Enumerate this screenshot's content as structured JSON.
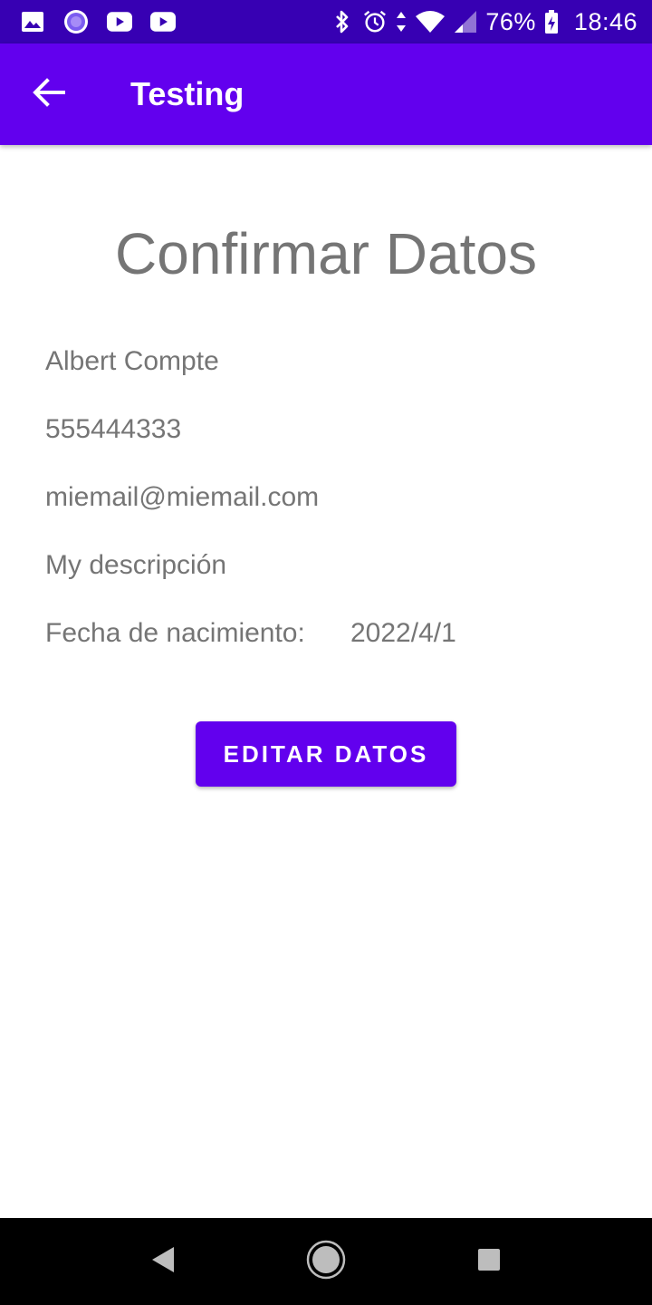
{
  "status_bar": {
    "notification_icons": [
      "image-icon",
      "loading-icon",
      "youtube-icon",
      "youtube-icon"
    ],
    "system_icons": [
      "bluetooth-icon",
      "alarm-icon",
      "data-arrows-icon",
      "wifi-icon",
      "signal-icon"
    ],
    "battery": "76%",
    "battery_icon": "battery-charging-icon",
    "time": "18:46"
  },
  "app_bar": {
    "back_icon": "arrow-back-icon",
    "title": "Testing",
    "color": "#6200ee",
    "status_color": "#3700b3"
  },
  "content": {
    "heading": "Confirmar Datos",
    "name": "Albert Compte",
    "phone": "555444333",
    "email": "miemail@miemail.com",
    "description": "My descripción",
    "birth_label": "Fecha de nacimiento:",
    "birth_value": "2022/4/1",
    "text_color": "#757575"
  },
  "actions": {
    "edit_label": "EDITAR DATOS"
  },
  "nav_bar": {
    "icons": [
      "nav-back-icon",
      "nav-home-icon",
      "nav-recents-icon"
    ]
  }
}
